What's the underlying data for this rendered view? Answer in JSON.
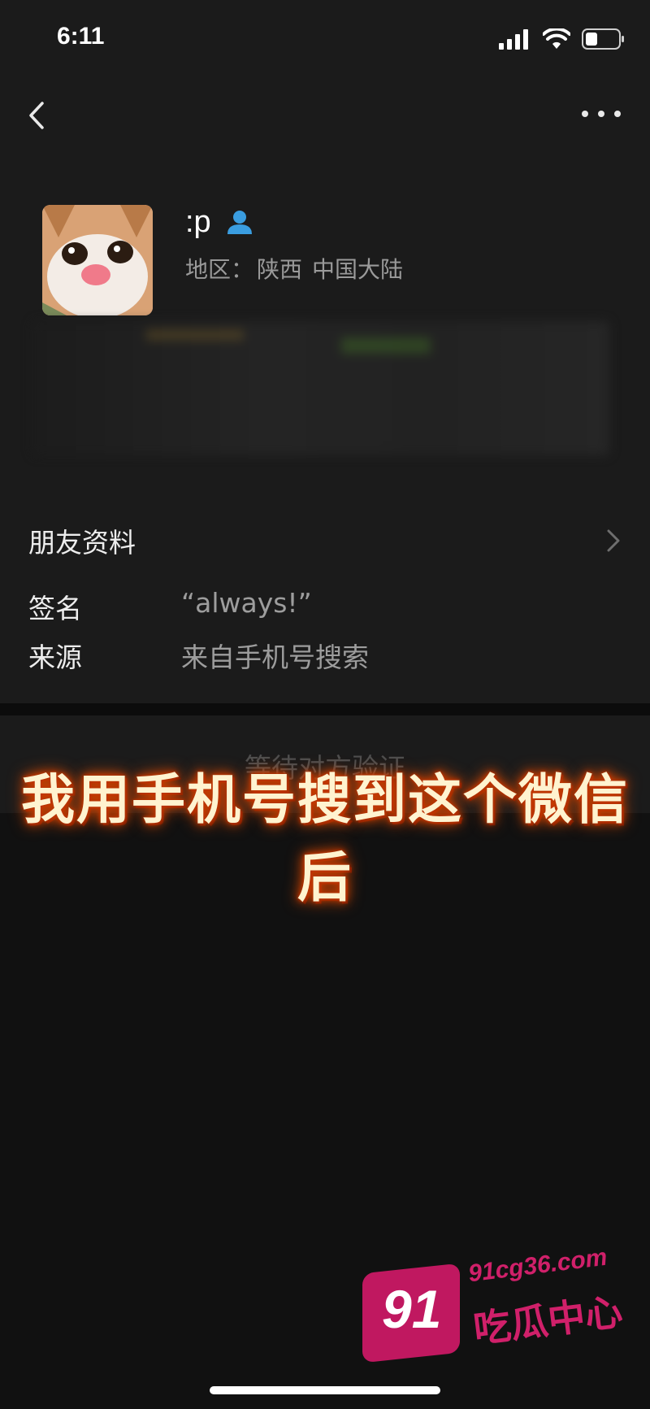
{
  "status_bar": {
    "time": "6:11",
    "icons": [
      "signal-icon",
      "wifi-icon",
      "battery-icon"
    ]
  },
  "nav": {
    "back_icon": "chevron-left-icon",
    "more_icon": "more-dots-icon"
  },
  "profile": {
    "name": ":p",
    "badge_icon": "person-icon",
    "region_label": "地区：",
    "region_province": "陕西",
    "region_country": "中国大陆"
  },
  "info": {
    "friend_profile_label": "朋友资料",
    "signature_label": "签名",
    "signature_value": "“always!”",
    "source_label": "来源",
    "source_value": "来自手机号搜索"
  },
  "verify": {
    "text": "等待对方验证"
  },
  "caption": {
    "text": "我用手机号搜到这个微信后"
  },
  "watermark": {
    "number": "91",
    "url": "91cg36.com",
    "name": "吃瓜中心"
  },
  "colors": {
    "background": "#111111",
    "panel": "#1b1b1b",
    "secondary_text": "#9d9d9d",
    "badge_blue": "#3a9de0",
    "watermark_pink": "#c01860"
  }
}
